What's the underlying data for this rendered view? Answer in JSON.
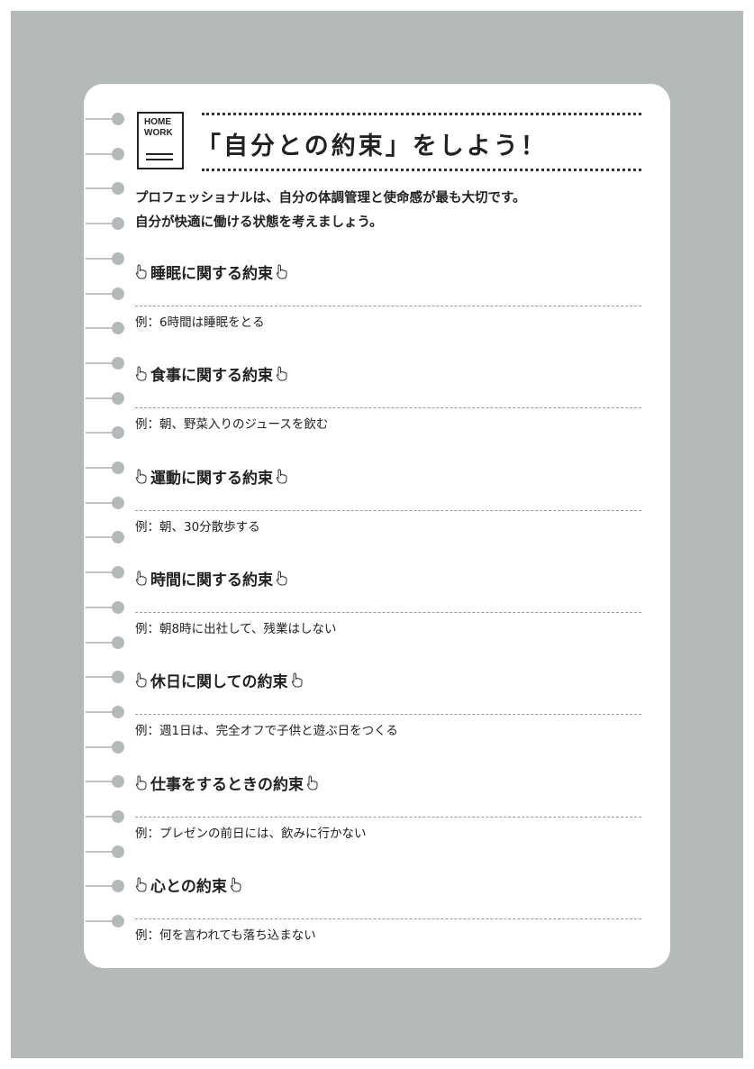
{
  "colors": {
    "background": "#b4b9b9",
    "paper": "#ffffff",
    "text": "#222222"
  },
  "badge": {
    "line1": "HOME",
    "line2": "WORK"
  },
  "title": "「自分との約束」をしよう！",
  "intro": [
    "プロフェッショナルは、自分の体調管理と使命感が最も大切です。",
    "自分が快適に働ける状態を考えましょう。"
  ],
  "icons": {
    "heading_marker": "pointing-hand-icon"
  },
  "sections": [
    {
      "heading": "睡眠に関する約束",
      "example": "例：6時間は睡眠をとる"
    },
    {
      "heading": "食事に関する約束",
      "example": "例：朝、野菜入りのジュースを飲む"
    },
    {
      "heading": "運動に関する約束",
      "example": "例：朝、30分散歩する"
    },
    {
      "heading": "時間に関する約束",
      "example": "例：朝8時に出社して、残業はしない"
    },
    {
      "heading": "休日に関しての約束",
      "example": "例：週1日は、完全オフで子供と遊ぶ日をつくる"
    },
    {
      "heading": "仕事をするときの約束",
      "example": "例：プレゼンの前日には、飲みに行かない"
    },
    {
      "heading": "心との約束",
      "example": "例：何を言われても落ち込まない"
    }
  ]
}
